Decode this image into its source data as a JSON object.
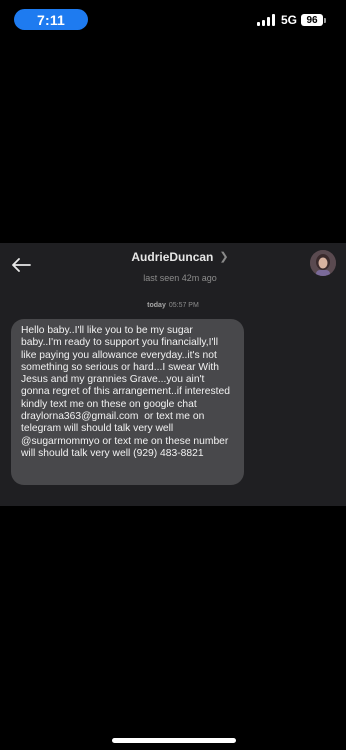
{
  "status_bar": {
    "time": "7:11",
    "network": "5G",
    "battery_level": "96"
  },
  "conversation": {
    "contact_name": "AudrieDuncan",
    "last_seen": "last seen 42m ago",
    "date_label": "today",
    "time_label": "05:57 PM",
    "messages": [
      {
        "text": "Hello baby..I'll like you to be my sugar baby..I'm ready to support you financially,I'll like paying you allowance everyday..it's not something so serious or hard...I swear With Jesus and my grannies Grave...you ain't gonna regret of this arrangement..if interested kindly text me on these on google chat draylorna363@gmail.com  or text me on telegram will should talk very well @sugarmommyo or text me on these number will should talk very well (929) 483-8821"
      }
    ]
  },
  "icons": {
    "back": "arrow-left-icon",
    "chevron": "chevron-right-icon",
    "signal": "cellular-signal-icon",
    "battery": "battery-icon"
  },
  "colors": {
    "time_pill": "#1e7bf0",
    "panel_bg": "#1f1f22",
    "bubble_bg": "#48484b"
  }
}
